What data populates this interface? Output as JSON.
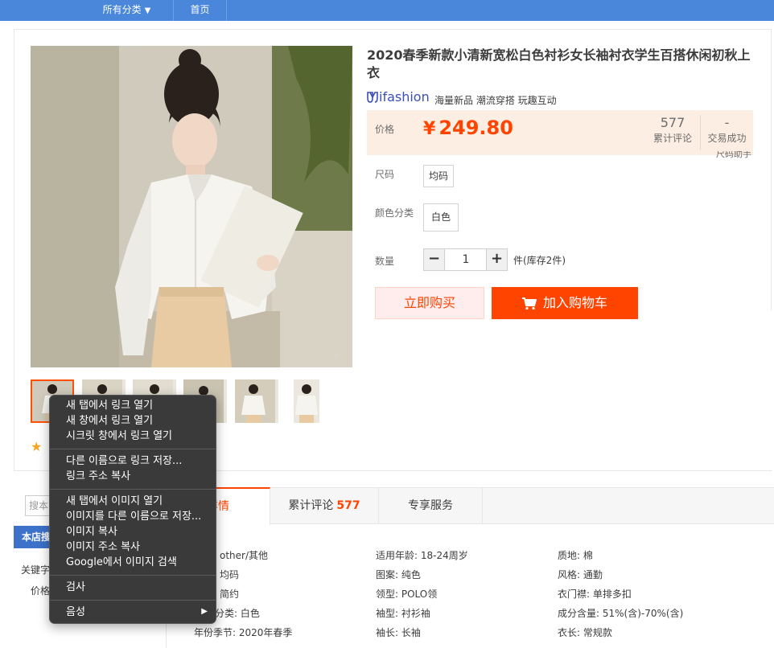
{
  "topnav": {
    "categories": "所有分类",
    "home": "首页"
  },
  "product": {
    "title": "2020春季新款小清新宽松白色衬衫女长袖衬衣学生百搭休闲初秋上衣",
    "brand_logo": "ifashion",
    "brand_tagline": "海量新品 潮流穿搭 玩趣互动",
    "price_label": "价格",
    "currency": "¥",
    "price": "249.80",
    "reviews_count": "577",
    "reviews_label": "累计评论",
    "deals_count": "-",
    "deals_label": "交易成功",
    "size_helper": "尺码助手",
    "size_label": "尺码",
    "size_option": "均码",
    "color_label": "颜色分类",
    "color_option": "白色",
    "qty_label": "数量",
    "qty_value": "1",
    "stock": "件(库存2件)",
    "buy_now": "立即购买",
    "add_cart": "加入购物车"
  },
  "sidebar": {
    "search_placeholder": "搜本",
    "header": "本店搜",
    "keyword_label": "关键字",
    "price_label": "价格"
  },
  "tabs": {
    "detail": "详情",
    "reviews": "累计评论",
    "reviews_count": "577",
    "service": "专享服务"
  },
  "attributes": [
    [
      "other/其他",
      "适用年龄: 18-24周岁",
      "质地: 棉"
    ],
    [
      "均码",
      "图案: 纯色",
      "风格: 通勤"
    ],
    [
      "简约",
      "领型: POLO领",
      "衣门襟: 单排多扣"
    ],
    [
      "分类: 白色",
      "袖型: 衬衫袖",
      "成分含量: 51%(含)-70%(含)"
    ],
    [
      "年份季节: 2020年春季",
      "袖长: 长袖",
      "衣长: 常规款"
    ]
  ],
  "context_menu": {
    "open_new_tab": "새 탭에서 링크 열기",
    "open_new_window": "새 창에서 링크 열기",
    "open_incognito": "시크릿 창에서 링크 열기",
    "save_link_as": "다른 이름으로 링크 저장...",
    "copy_link": "링크 주소 복사",
    "open_image_tab": "새 탭에서 이미지 열기",
    "save_image_as": "이미지를 다른 이름으로 저장...",
    "copy_image": "이미지 복사",
    "copy_image_address": "이미지 주소 복사",
    "google_image_search": "Google에서 이미지 검색",
    "inspect": "검사",
    "speech": "음성"
  },
  "colors": {
    "accent": "#ff4400",
    "nav_blue": "#4a86d9",
    "price_bg": "#fdeee3",
    "menu_bg": "#3a3a3a"
  }
}
